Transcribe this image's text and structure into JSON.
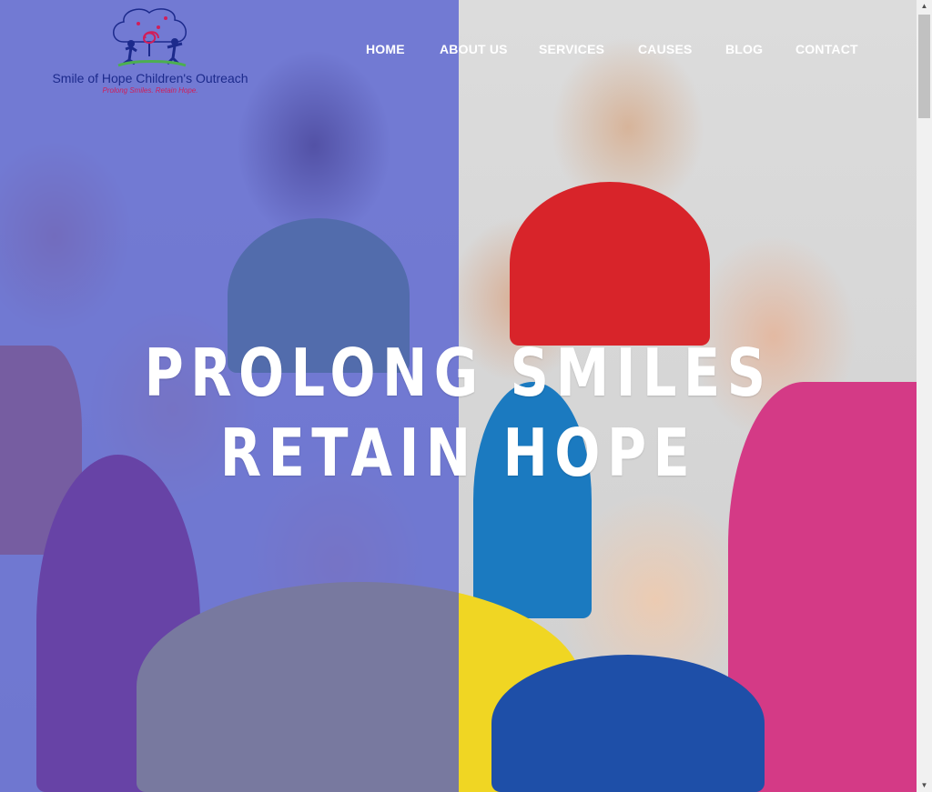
{
  "brand": {
    "name": "Smile of Hope Children's Outreach",
    "tagline": "Prolong Smiles. Retain Hope.",
    "colors": {
      "name": "#1c2a8c",
      "tagline": "#d01e5a",
      "overlay": "#4a54d0"
    }
  },
  "nav": {
    "items": [
      {
        "label": "HOME"
      },
      {
        "label": "ABOUT US"
      },
      {
        "label": "SERVICES"
      },
      {
        "label": "CAUSES"
      },
      {
        "label": "BLOG"
      },
      {
        "label": "CONTACT"
      }
    ]
  },
  "hero": {
    "line1": "PROLONG SMILES",
    "line2": "RETAIN HOPE",
    "image": "group-of-smiling-children"
  },
  "scrollbar": {
    "up_icon": "arrow-up-icon",
    "down_icon": "arrow-down-icon"
  }
}
